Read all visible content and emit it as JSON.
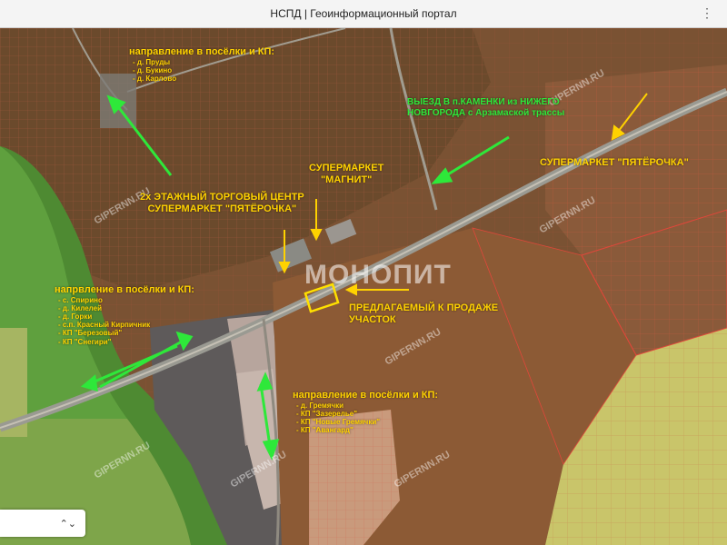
{
  "window": {
    "title": "НСПД | Геоинформационный портал",
    "menu_icon": "more-dots-icon"
  },
  "labels": {
    "north_dir": {
      "title": "направление в посёлки и КП:",
      "items": [
        "- д. Пруды",
        "- д. Букино",
        "- д. Карлово"
      ]
    },
    "exit_nn": [
      "ВЫЕЗД В п.КАМЕНКИ из НИЖЕГО",
      "НОВГОРОДА с Арзамаской трассы"
    ],
    "magnit": [
      "СУПЕРМАРКЕТ",
      "\"МАГНИТ\""
    ],
    "pyaterochka_east": "СУПЕРМАРКЕТ \"ПЯТЁРОЧКА\"",
    "trade_center": [
      "2х ЭТАЖНЫЙ ТОРГОВЫЙ ЦЕНТР",
      "СУПЕРМАРКЕТ \"ПЯТЁРОЧКА\""
    ],
    "west_dir": {
      "title": "напрвление  в посёлки и КП:",
      "items": [
        "- с. Спирино",
        "- д. Килелей",
        "- д. Горки",
        "- с.п. Красный Кирпичник",
        "- КП \"Березовый\"",
        "- КП \"Снегири\""
      ]
    },
    "plot": [
      "ПРЕДЛАГАЕМЫЙ К ПРОДАЖЕ",
      "УЧАСТОК"
    ],
    "south_dir": {
      "title": "направление в посёлки и КП:",
      "items": [
        "- д. Гремячки",
        "- КП \"Зазерелье\"",
        "- КП \"Новые Гремячки\"",
        "- КП \"Авангард\""
      ]
    }
  },
  "watermark": "GIPERNN.RU",
  "center_watermark": "МОНОПИТ",
  "colors": {
    "label_yellow": "#ffd200",
    "arrow_green": "#2ee83a",
    "parcel_red": "#e0473a"
  },
  "control": {
    "icon": "chevron-updown-icon",
    "glyph": "⌃⌄"
  }
}
